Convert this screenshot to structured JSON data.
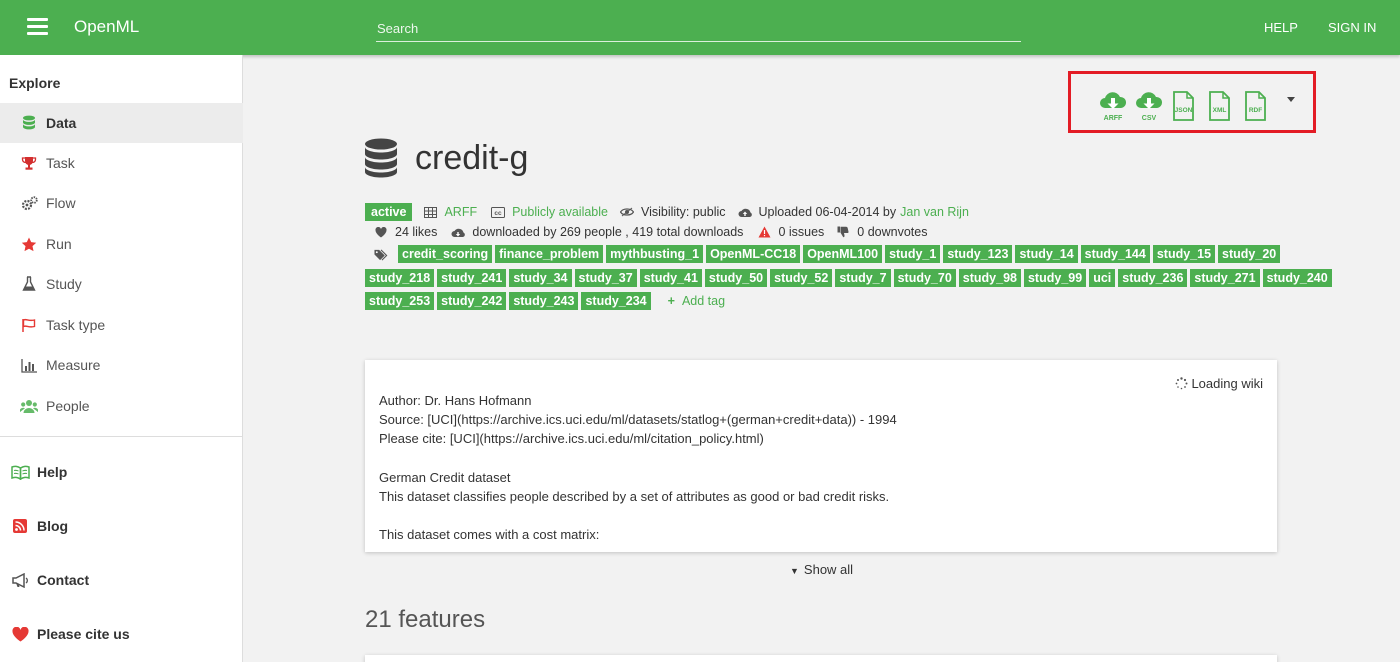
{
  "header": {
    "brand": "OpenML",
    "search_placeholder": "Search",
    "help": "HELP",
    "sign_in": "SIGN IN"
  },
  "sidebar": {
    "explore": "Explore",
    "items": [
      {
        "label": "Data",
        "icon": "database-icon"
      },
      {
        "label": "Task",
        "icon": "trophy-icon"
      },
      {
        "label": "Flow",
        "icon": "cogs-icon"
      },
      {
        "label": "Run",
        "icon": "star-icon"
      },
      {
        "label": "Study",
        "icon": "flask-icon"
      },
      {
        "label": "Task type",
        "icon": "flag-icon"
      },
      {
        "label": "Measure",
        "icon": "bar-chart-icon"
      },
      {
        "label": "People",
        "icon": "people-icon"
      }
    ],
    "bottom_items": [
      {
        "label": "Help",
        "icon": "book-icon"
      },
      {
        "label": "Blog",
        "icon": "rss-icon"
      },
      {
        "label": "Contact",
        "icon": "megaphone-icon"
      },
      {
        "label": "Please cite us",
        "icon": "heart-icon"
      }
    ]
  },
  "downloads": {
    "arff": "ARFF",
    "csv": "CSV",
    "json": "JSON",
    "xml": "XML",
    "rdf": "RDF"
  },
  "dataset": {
    "title": "credit-g",
    "status": "active",
    "format": "ARFF",
    "license": "Publicly available",
    "visibility": "Visibility: public",
    "uploaded": "Uploaded 06-04-2014 by",
    "uploader": "Jan van Rijn",
    "likes": "24 likes",
    "downloads": "downloaded by 269 people , 419 total downloads",
    "issues": "0 issues",
    "downvotes": "0 downvotes",
    "tags_row1": [
      "credit_scoring",
      "finance_problem",
      "mythbusting_1",
      "OpenML-CC18",
      "OpenML100",
      "study_1",
      "study_123",
      "study_14",
      "study_144",
      "study_15",
      "study_20"
    ],
    "tags_row2": [
      "study_218",
      "study_241",
      "study_34",
      "study_37",
      "study_41",
      "study_50",
      "study_52",
      "study_7",
      "study_70",
      "study_98",
      "study_99",
      "uci",
      "study_236",
      "study_271",
      "study_240"
    ],
    "tags_row3": [
      "study_253",
      "study_242",
      "study_243",
      "study_234"
    ],
    "add_tag": "Add tag"
  },
  "wiki": {
    "loading": "Loading wiki",
    "lines": [
      "Author: Dr. Hans Hofmann",
      "Source: [UCI](https://archive.ics.uci.edu/ml/datasets/statlog+(german+credit+data)) - 1994",
      "Please cite: [UCI](https://archive.ics.uci.edu/ml/citation_policy.html)",
      "German Credit dataset",
      "This dataset classifies people described by a set of attributes as good or bad credit risks.",
      "This dataset comes with a cost matrix:"
    ],
    "show_all": "Show all"
  },
  "features_heading": "21 features",
  "colors": {
    "brand_green": "#4caf50",
    "highlight_red": "#e31c25"
  }
}
